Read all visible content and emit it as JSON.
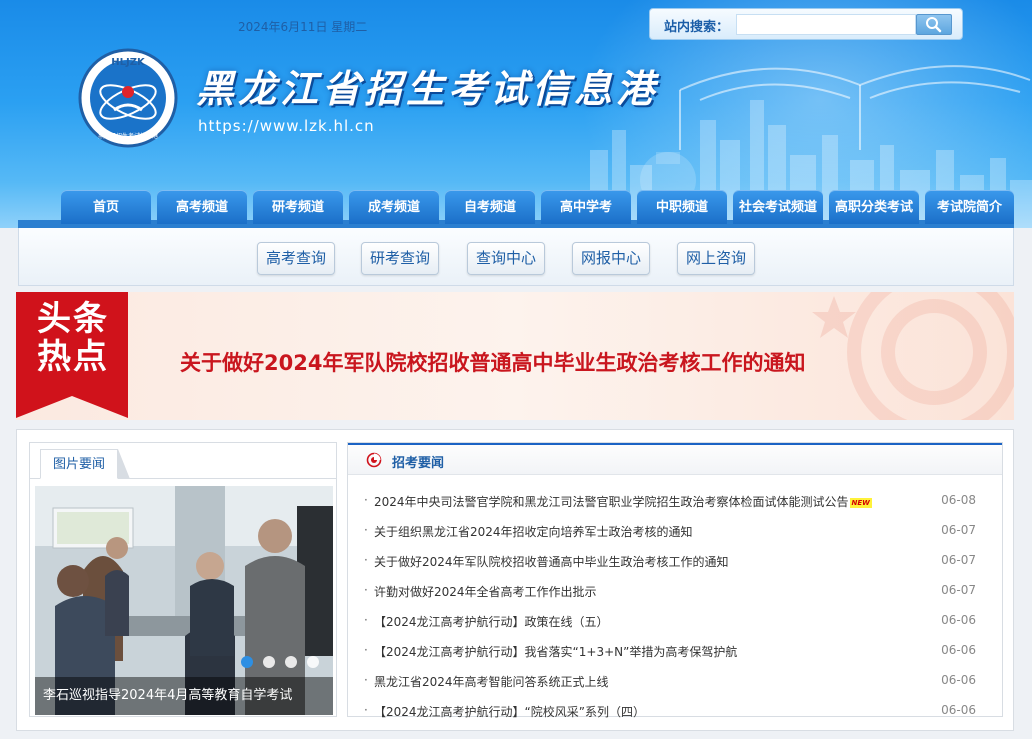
{
  "header": {
    "date": "2024年6月11日 星期二",
    "search_label": "站内搜索：",
    "search_placeholder": "",
    "logo_text": "HLJZK",
    "logo_subtext": "黑龙江招生考试信息港",
    "site_title": "黑龙江省招生考试信息港",
    "site_url": "https://www.lzk.hl.cn"
  },
  "nav": {
    "items": [
      "首页",
      "高考频道",
      "研考频道",
      "成考频道",
      "自考频道",
      "高中学考",
      "中职频道",
      "社会考试频道",
      "高职分类考试",
      "考试院简介"
    ]
  },
  "quick_links": [
    "高考查询",
    "研考查询",
    "查询中心",
    "网报中心",
    "网上咨询"
  ],
  "headline": {
    "ribbon_line1": "头条",
    "ribbon_line2": "热点",
    "title": "关于做好2024年军队院校招收普通高中毕业生政治考核工作的通知"
  },
  "photo_news": {
    "tab": "图片要闻",
    "caption": "李石巡视指导2024年4月高等教育自学考试",
    "slides": 4,
    "active_slide": 1
  },
  "news": {
    "title": "招考要闻",
    "badge": "NEW",
    "items": [
      {
        "text": "2024年中央司法警官学院和黑龙江司法警官职业学院招生政治考察体检面试体能测试公告",
        "date": "06-08",
        "is_new": true
      },
      {
        "text": "关于组织黑龙江省2024年招收定向培养军士政治考核的通知",
        "date": "06-07",
        "is_new": false
      },
      {
        "text": "关于做好2024年军队院校招收普通高中毕业生政治考核工作的通知",
        "date": "06-07",
        "is_new": false
      },
      {
        "text": "许勤对做好2024年全省高考工作作出批示",
        "date": "06-07",
        "is_new": false
      },
      {
        "text": "【2024龙江高考护航行动】政策在线（五）",
        "date": "06-06",
        "is_new": false
      },
      {
        "text": "【2024龙江高考护航行动】我省落实“1+3+N”举措为高考保驾护航",
        "date": "06-06",
        "is_new": false
      },
      {
        "text": "黑龙江省2024年高考智能问答系统正式上线",
        "date": "06-06",
        "is_new": false
      },
      {
        "text": "【2024龙江高考护航行动】“院校风采”系列（四）",
        "date": "06-06",
        "is_new": false
      }
    ]
  },
  "colors": {
    "brand_blue": "#1b6fc8",
    "headline_red": "#c9161e",
    "ribbon_red": "#d0121b"
  }
}
